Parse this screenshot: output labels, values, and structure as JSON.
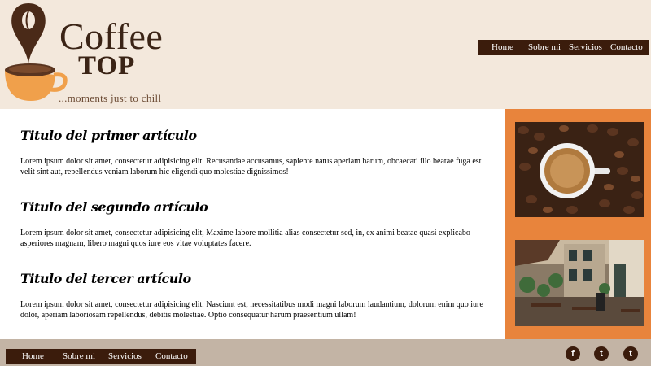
{
  "brand": {
    "name_line1": "Coffee",
    "name_line2": "TOP",
    "tagline": "...moments just to chill",
    "colors": {
      "header_bg": "#f3e8dc",
      "nav_bg": "#3b1c0c",
      "accent_orange": "#e8843c",
      "footer_bg": "#c3b4a5",
      "logo_brown": "#3b2416"
    }
  },
  "nav_top": {
    "items": [
      "Home",
      "Sobre mi",
      "Servicios",
      "Contacto"
    ]
  },
  "articles": [
    {
      "title": "Titulo del primer artículo",
      "body": "Lorem ipsum dolor sit amet, consectetur adipisicing elit. Recusandae accusamus, sapiente natus aperiam harum, obcaecati illo beatae fuga est velit sint aut, repellendus veniam laborum hic eligendi quo molestiae dignissimos!"
    },
    {
      "title": "Titulo del segundo artículo",
      "body": "Lorem ipsum dolor sit amet, consectetur adipisicing elit, Maxime labore mollitia alias consectetur sed, in, ex animi beatae quasi explicabo asperiores magnam, libero magni quos iure eos vitae voluptates facere."
    },
    {
      "title": "Titulo del tercer artículo",
      "body": "Lorem ipsum dolor sit amet, consectetur adipisicing elit. Nasciunt est, necessitatibus modi magni laborum laudantium, dolorum enim quo iure dolor, aperiam laboriosam repellendus, debitis molestiae. Optio consequatur harum praesentium ullam!"
    }
  ],
  "aside": {
    "images": [
      "coffee-cup-on-beans-photo",
      "street-cafe-photo"
    ]
  },
  "footer": {
    "nav_items": [
      "Home",
      "Sobre mi",
      "Servicios",
      "Contacto"
    ],
    "social": [
      {
        "icon": "facebook-icon",
        "glyph": "f"
      },
      {
        "icon": "twitter-icon",
        "glyph": "t"
      },
      {
        "icon": "twitter-icon",
        "glyph": "t"
      }
    ]
  }
}
